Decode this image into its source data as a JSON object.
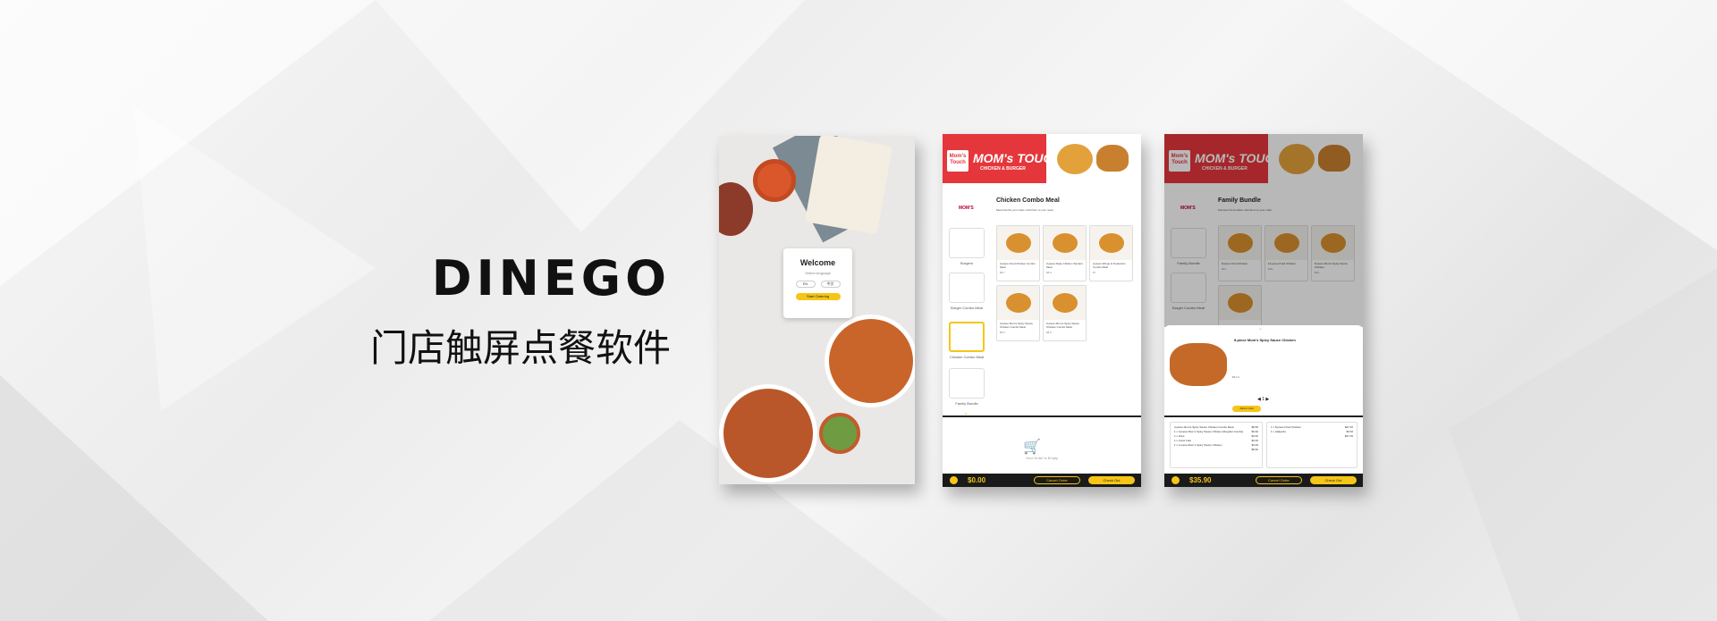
{
  "brand": {
    "name": "DINEGO",
    "tagline": "门店触屏点餐软件"
  },
  "welcome": {
    "title": "Welcome",
    "subtitle": "Select language",
    "lang1": "EN",
    "lang2": "中文",
    "start": "Start Ordering"
  },
  "kiosk": {
    "brand_name": "MOM's TOUCH",
    "brand_tag": "CHICKEN & BURGER",
    "logo_text": "Mom's Touch",
    "side_logo": "MOM'S",
    "categories": [
      "Burgers",
      "Burger Combo Meal",
      "Chicken Combo Meal",
      "Family Bundle"
    ],
    "cancel": "Cancel Order",
    "checkout": "Check Out"
  },
  "screen2": {
    "title": "Chicken Combo Meal",
    "subtitle": "Meat that fits your sides. Add them to your meal.",
    "products": [
      {
        "name": "3-piece Fried Chicken Combo Meal",
        "price": "$8.7"
      },
      {
        "name": "3-piece Flaky Chicken Tenders Meal",
        "price": "$8.9"
      },
      {
        "name": "2-piece Wings & Tenderloin Combo Meal",
        "price": "$7"
      },
      {
        "name": "3-piece Mom's Spicy Sauce Chicken Combo Meal",
        "price": "$8.9"
      },
      {
        "name": "3-piece Mom's Spicy Sauce Chicken Combo Meal",
        "price": "$8.9"
      }
    ],
    "empty": "Your Order Is Empty",
    "total": "$0.00"
  },
  "screen3": {
    "title": "Family Bundle",
    "subtitle": "Discover the bundles. Add them to your order.",
    "products": [
      {
        "name": "8-piece Fried Chicken",
        "price": "$14"
      },
      {
        "name": "12-piece Fried Chicken",
        "price": "$19"
      },
      {
        "name": "8-piece Mom's Spicy Sauce Chicken",
        "price": "$16"
      }
    ],
    "modal_name": "8-piece Mom's Spicy Sauce Chicken",
    "modal_price": "$21.9",
    "qty": "1",
    "add_to_cart": "Add to Cart",
    "order1": [
      {
        "name": "3-piece Mom's Spicy Sauce Chicken Combo Meal",
        "price": "$8.90"
      },
      {
        "name": "1 x 3-piece Mom's Spicy Sauce Chicken (Regular Combo)",
        "price": "$6.90"
      },
      {
        "name": "1 x Fries",
        "price": "$0.00"
      },
      {
        "name": "1 x Coca Cola",
        "price": "$0.00"
      },
      {
        "name": "1 x 1-piece Mom's Spicy Sauce Chicken",
        "price": "$3.00"
      }
    ],
    "order1_total": "$8.90",
    "order2": [
      {
        "name": "1 x 8-piece Fried Chicken",
        "price": "$27.00"
      },
      {
        "name": "1 x Jalapeño",
        "price": "$0.00"
      }
    ],
    "order2_total": "$27.00",
    "total": "$35.90"
  }
}
